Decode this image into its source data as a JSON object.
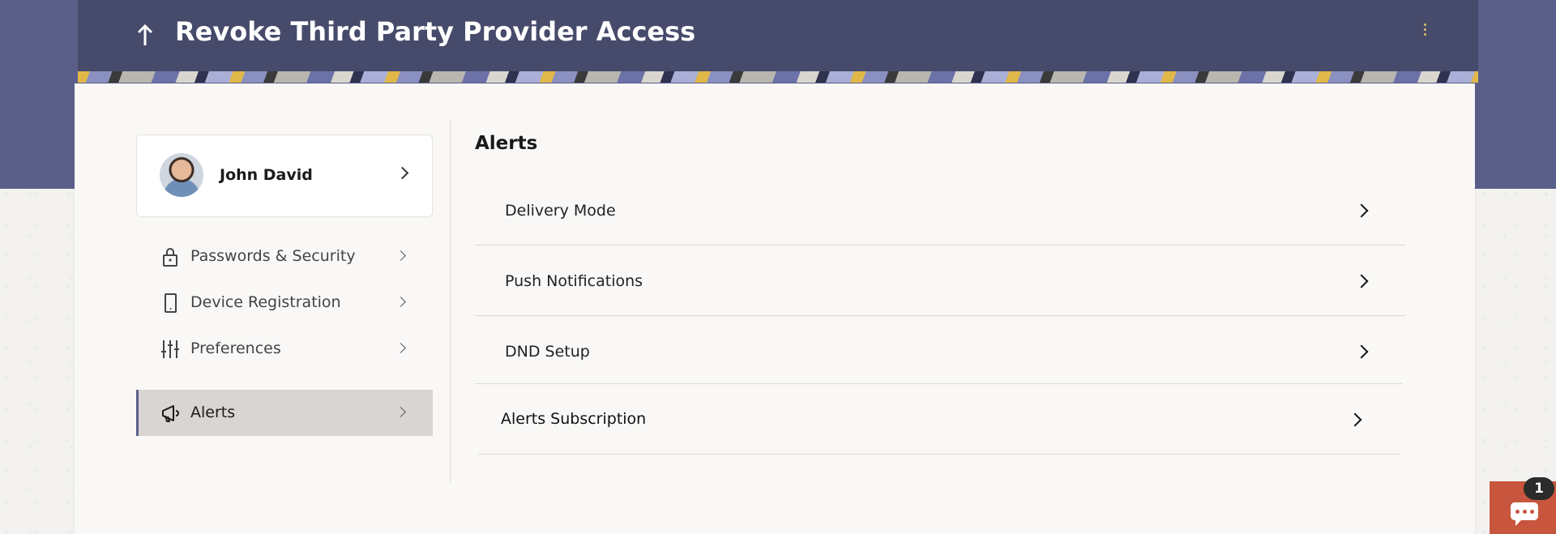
{
  "header": {
    "title": "Revoke Third Party Provider Access",
    "back_icon": "arrow-up-icon",
    "menu_icon": "kebab-menu-icon"
  },
  "profile": {
    "name": "John David"
  },
  "sidebar": {
    "items": [
      {
        "label": "Passwords & Security",
        "icon": "lock-icon"
      },
      {
        "label": "Device Registration",
        "icon": "mobile-device-icon"
      },
      {
        "label": "Preferences",
        "icon": "sliders-icon"
      },
      {
        "label": "Alerts",
        "icon": "megaphone-icon",
        "active": true
      }
    ]
  },
  "main": {
    "title": "Alerts",
    "rows": [
      {
        "label": "Delivery Mode"
      },
      {
        "label": "Push Notifications"
      },
      {
        "label": "DND Setup"
      },
      {
        "label": "Alerts Subscription"
      }
    ]
  },
  "chat": {
    "badge_count": "1",
    "icon": "chat-icon"
  },
  "colors": {
    "header_bg": "#474b6b",
    "hero_bg": "#5a5f8a",
    "accent": "#5b6189",
    "chat": "#c8553d"
  }
}
